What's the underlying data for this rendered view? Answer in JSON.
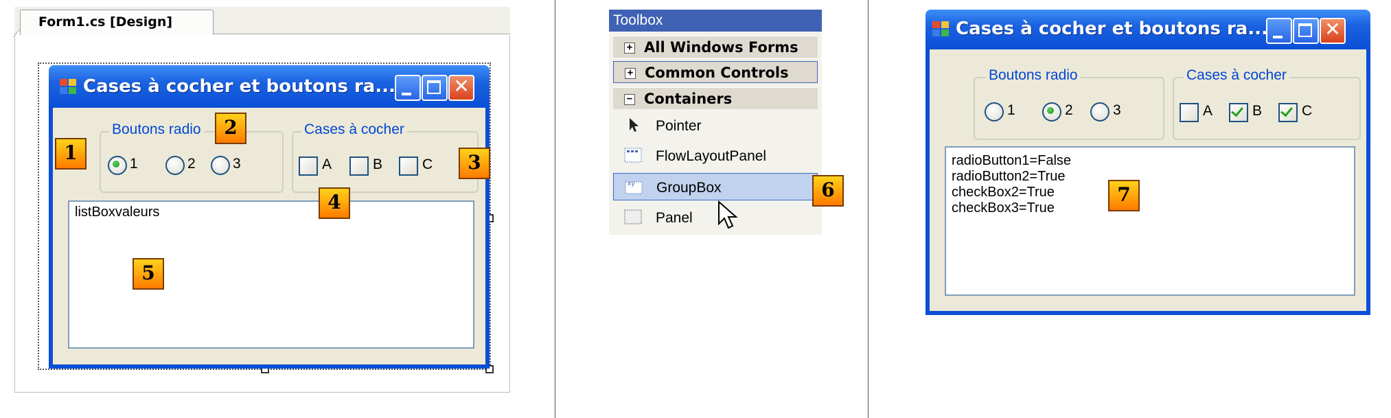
{
  "designer": {
    "tab_title": "Form1.cs [Design]",
    "window_title": "Cases à cocher et boutons ra...",
    "radio_group_label": "Boutons radio",
    "radio_labels": [
      "1",
      "2",
      "3"
    ],
    "check_group_label": "Cases à cocher",
    "check_labels": [
      "A",
      "B",
      "C"
    ],
    "listbox_text": "listBoxvaleurs",
    "callouts": [
      "1",
      "2",
      "3",
      "4",
      "5"
    ]
  },
  "toolbox": {
    "title": "Toolbox",
    "categories": [
      {
        "label": "All Windows Forms",
        "expander": "+"
      },
      {
        "label": "Common Controls",
        "expander": "+"
      },
      {
        "label": "Containers",
        "expander": "−"
      }
    ],
    "items": [
      "Pointer",
      "FlowLayoutPanel",
      "GroupBox",
      "Panel"
    ],
    "groupbox_icon_text": "xy",
    "callout": "6"
  },
  "runtime": {
    "window_title": "Cases à cocher et boutons ra...",
    "radio_group_label": "Boutons radio",
    "radio_labels": [
      "1",
      "2",
      "3"
    ],
    "radio_selected": "2",
    "check_group_label": "Cases à cocher",
    "check_labels": [
      "A",
      "B",
      "C"
    ],
    "checked": [
      "B",
      "C"
    ],
    "listbox_lines": [
      "radioButton1=False",
      "radioButton2=True",
      "checkBox2=True",
      "checkBox3=True"
    ],
    "callout": "7"
  },
  "colors": {
    "xp_title_blue": "#0a4fd6",
    "client_bg": "#ece9d8",
    "group_label_blue": "#0046d5",
    "badge_orange": "#ff9a00"
  }
}
